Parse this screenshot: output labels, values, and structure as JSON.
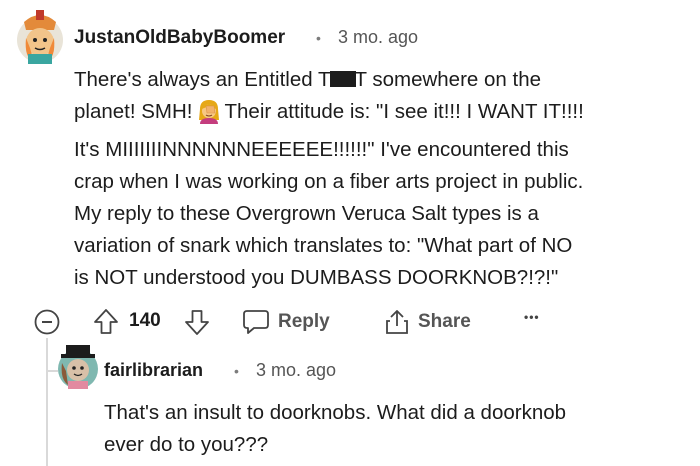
{
  "comment": {
    "author": "JustanOldBabyBoomer",
    "separator": "•",
    "time": "3 mo. ago",
    "lines": [
      {
        "a": "There's always an Entitled T",
        "b": "T somewhere on the"
      },
      {
        "a": "planet! SMH!",
        "b": "Their attitude is: \"I see it!!! I WANT IT!!!!"
      },
      {
        "text": "It's MIIIIIIINNNNNNEEEEEE!!!!!!\" I've encountered this"
      },
      {
        "text": "crap when I was working on a fiber arts project in public."
      },
      {
        "text": "My reply to these Overgrown Veruca Salt types is a"
      },
      {
        "text": "variation of snark which translates to: \"What part of NO"
      },
      {
        "text": "is NOT understood you DUMBASS DOORKNOB?!?!\""
      }
    ],
    "votes": "140",
    "reply_label": "Reply",
    "share_label": "Share",
    "more_label": "•••"
  },
  "reply": {
    "author": "fairlibrarian",
    "separator": "•",
    "time": "3 mo. ago",
    "lines": [
      "That's an insult to doorknobs. What did a doorknob",
      "ever do to you???"
    ]
  },
  "icons": {
    "collapse": "minus-circle-icon",
    "upvote": "arrow-up-icon",
    "downvote": "arrow-down-icon",
    "reply": "speech-bubble-icon",
    "share": "share-icon",
    "more": "more-dots-icon",
    "emoji": "woman-facepalming-emoji"
  },
  "colors": {
    "text": "#1c1c1c",
    "muted": "#7c7c7c",
    "thread_line": "#d9d9d9"
  }
}
